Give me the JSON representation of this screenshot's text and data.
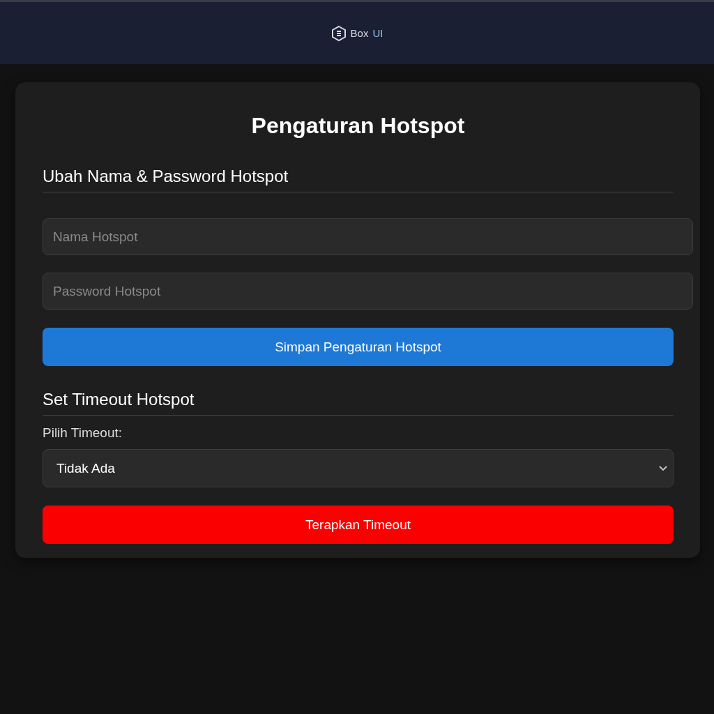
{
  "header": {
    "brand": {
      "name": "Box",
      "accent": "UI"
    }
  },
  "title": "Pengaturan Hotspot",
  "sections": [
    {
      "heading": "Ubah Nama & Password Hotspot",
      "fields": [
        {
          "kind": "input",
          "placeholder": "Nama Hotspot"
        },
        {
          "kind": "input",
          "placeholder": "Password Hotspot"
        }
      ],
      "button": {
        "label": "Simpan Pengaturan Hotspot",
        "kind": "primary"
      }
    },
    {
      "heading": "Set Timeout Hotspot",
      "fields": [
        {
          "kind": "label",
          "text": "Pilih Timeout:"
        },
        {
          "kind": "select",
          "value": "Tidak Ada"
        }
      ],
      "button": {
        "label": "Terapkan Timeout",
        "kind": "danger"
      }
    }
  ]
}
